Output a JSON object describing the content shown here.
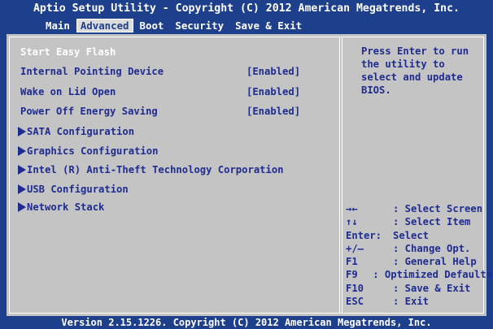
{
  "header": {
    "title": "Aptio Setup Utility - Copyright (C) 2012 American Megatrends, Inc."
  },
  "tabs": [
    {
      "label": "Main"
    },
    {
      "label": "Advanced",
      "active": true
    },
    {
      "label": "Boot"
    },
    {
      "label": "Security"
    },
    {
      "label": "Save & Exit"
    }
  ],
  "menu": {
    "items": [
      {
        "label": "Start Easy Flash",
        "value": "",
        "highlighted": true
      },
      {
        "label": "Internal Pointing Device",
        "value": "[Enabled]"
      },
      {
        "label": "Wake on Lid Open",
        "value": "[Enabled]"
      },
      {
        "label": "Power Off Energy Saving",
        "value": "[Enabled]"
      },
      {
        "label": "SATA Configuration",
        "submenu": true
      },
      {
        "label": "Graphics Configuration",
        "submenu": true
      },
      {
        "label": "Intel (R) Anti-Theft Technology Corporation",
        "submenu": true
      },
      {
        "label": "USB Configuration",
        "submenu": true
      },
      {
        "label": "Network Stack",
        "submenu": true
      }
    ]
  },
  "help": {
    "lines": [
      "Press Enter to run",
      "the utility to",
      "select and update",
      "BIOS."
    ]
  },
  "keys": [
    {
      "key": "→←",
      "desc": ": Select Screen"
    },
    {
      "key": "↑↓",
      "desc": ": Select Item"
    },
    {
      "key": "Enter:",
      "desc": "Select"
    },
    {
      "key": "+/—",
      "desc": ": Change Opt."
    },
    {
      "key": "F1",
      "desc": ": General Help"
    },
    {
      "key": "F9",
      "desc": ": Optimized Defaults"
    },
    {
      "key": "F10",
      "desc": ": Save & Exit"
    },
    {
      "key": "ESC",
      "desc": ": Exit"
    }
  ],
  "footer": {
    "text": "Version 2.15.1226. Copyright (C) 2012 American Megatrends, Inc."
  },
  "colors": {
    "background": "#1e3f8c",
    "panel": "#c4c4c4",
    "text": "#1f2c8f",
    "highlight_text": "#ffffff"
  }
}
